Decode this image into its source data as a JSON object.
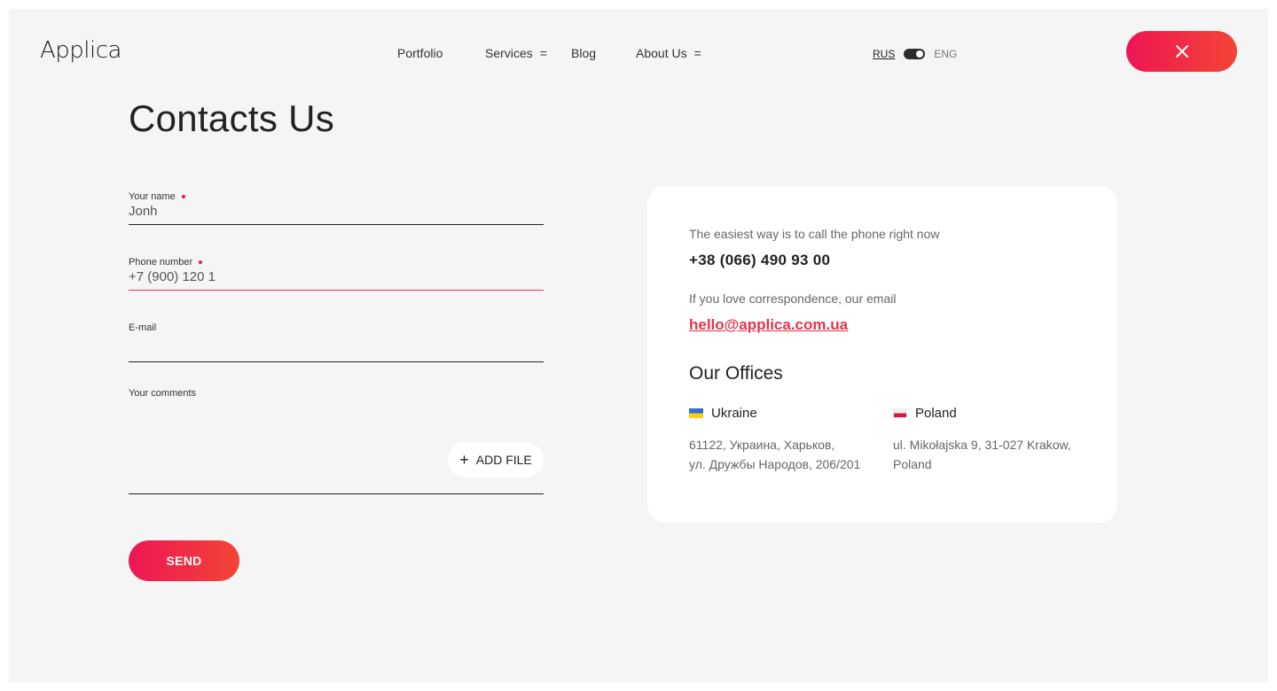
{
  "header": {
    "logo": "Applica",
    "nav": [
      {
        "label": "Portfolio",
        "has_menu": false
      },
      {
        "label": "Services",
        "has_menu": true
      },
      {
        "label": "Blog",
        "has_menu": false
      },
      {
        "label": "About Us",
        "has_menu": true
      }
    ],
    "menu_icon": "=",
    "lang": {
      "rus": "RUS",
      "eng": "ENG",
      "active": "RUS"
    },
    "close_icon": "close-icon"
  },
  "page": {
    "title": "Contacts Us"
  },
  "form": {
    "name": {
      "label": "Your name",
      "value": "Jonh",
      "required": true
    },
    "phone": {
      "label": "Phone number",
      "value": "+7 (900) 120 1",
      "required": true,
      "state": "error"
    },
    "email": {
      "label": "E-mail",
      "value": ""
    },
    "comments": {
      "label": "Your comments",
      "value": ""
    },
    "add_file": {
      "icon": "+",
      "label": "ADD FILE"
    },
    "send": "SEND"
  },
  "contact": {
    "phone_hint": "The easiest way is to call the phone right now",
    "phone": "+38 (066) 490 93 00",
    "email_hint": "If you love correspondence, our email",
    "email": "hello@applica.com.ua",
    "offices_title": "Our Offices",
    "offices": [
      {
        "country": "Ukraine",
        "flag": "flag-ukraine-icon",
        "address_line1": "61122, Украина, Харьков,",
        "address_line2": "ул. Дружбы Народов, 206/201"
      },
      {
        "country": "Poland",
        "flag": "flag-poland-icon",
        "address_line1": "ul. Mikołajska 9, 31-027 Krakow,",
        "address_line2": "Poland"
      }
    ]
  },
  "colors": {
    "accent_start": "#ed1654",
    "accent_end": "#f44436",
    "background": "#f5f5f5",
    "error": "#e8344a"
  }
}
